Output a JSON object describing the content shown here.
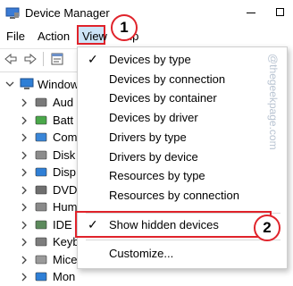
{
  "window": {
    "title": "Device Manager"
  },
  "menu": {
    "file": "File",
    "action": "Action",
    "view": "View",
    "help_fragment": "elp"
  },
  "tree": {
    "root": "Window",
    "items": [
      {
        "label": "Aud",
        "icon": "audio-icon"
      },
      {
        "label": "Batt",
        "icon": "battery-icon"
      },
      {
        "label": "Com",
        "icon": "computer-icon"
      },
      {
        "label": "Disk",
        "icon": "disk-icon"
      },
      {
        "label": "Disp",
        "icon": "display-icon"
      },
      {
        "label": "DVD",
        "icon": "dvd-icon"
      },
      {
        "label": "Hum",
        "icon": "hid-icon"
      },
      {
        "label": "IDE ",
        "icon": "ide-icon"
      },
      {
        "label": "Keyb",
        "icon": "keyboard-icon"
      },
      {
        "label": "Mice",
        "icon": "mouse-icon"
      },
      {
        "label": "Mon",
        "icon": "monitor-icon"
      }
    ]
  },
  "view_menu": {
    "items": [
      {
        "label": "Devices by type",
        "checked": true
      },
      {
        "label": "Devices by connection",
        "checked": false
      },
      {
        "label": "Devices by container",
        "checked": false
      },
      {
        "label": "Devices by driver",
        "checked": false
      },
      {
        "label": "Drivers by type",
        "checked": false
      },
      {
        "label": "Drivers by device",
        "checked": false
      },
      {
        "label": "Resources by type",
        "checked": false
      },
      {
        "label": "Resources by connection",
        "checked": false
      }
    ],
    "show_hidden": {
      "label": "Show hidden devices",
      "checked": true
    },
    "customize": "Customize...",
    "check_mark": "✓"
  },
  "callouts": {
    "first": "1",
    "second": "2"
  },
  "watermark": "@thegeekpage.com",
  "colors": {
    "highlight": "#cce4f7",
    "annotation": "#e0232b"
  }
}
